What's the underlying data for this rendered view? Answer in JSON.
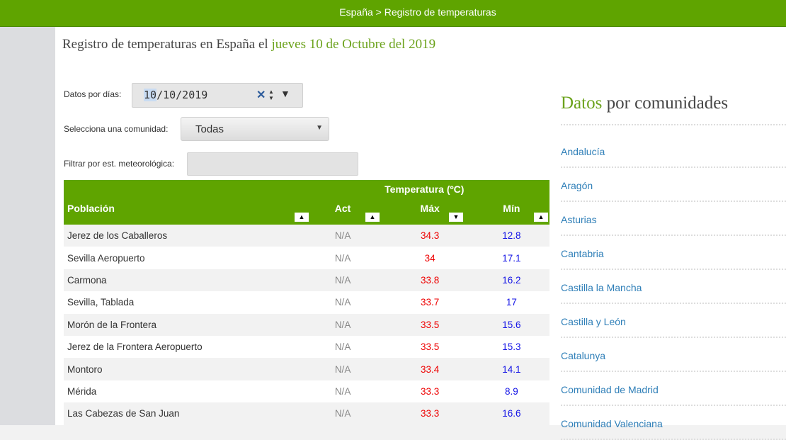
{
  "header": {
    "breadcrumb": "España > Registro de temperaturas"
  },
  "title": {
    "prefix": "Registro de temperaturas en España el",
    "date": "jueves 10 de Octubre del 2019"
  },
  "filters": {
    "date_label": "Datos por días:",
    "date_day": "10",
    "date_rest": "/10/2019",
    "community_label": "Selecciona una comunidad:",
    "community_value": "Todas",
    "station_label": "Filtrar por est. meteorológica:",
    "station_value": ""
  },
  "table": {
    "group_header": "Temperatura (ºC)",
    "headers": [
      "Población",
      "Act",
      "Máx",
      "Mín"
    ],
    "rows": [
      [
        "Jerez de los Caballeros",
        "N/A",
        "34.3",
        "12.8"
      ],
      [
        "Sevilla Aeropuerto",
        "N/A",
        "34",
        "17.1"
      ],
      [
        "Carmona",
        "N/A",
        "33.8",
        "16.2"
      ],
      [
        "Sevilla, Tablada",
        "N/A",
        "33.7",
        "17"
      ],
      [
        "Morón de la Frontera",
        "N/A",
        "33.5",
        "15.6"
      ],
      [
        "Jerez de la Frontera Aeropuerto",
        "N/A",
        "33.5",
        "15.3"
      ],
      [
        "Montoro",
        "N/A",
        "33.4",
        "14.1"
      ],
      [
        "Mérida",
        "N/A",
        "33.3",
        "8.9"
      ],
      [
        "Las Cabezas de San Juan",
        "N/A",
        "33.3",
        "16.6"
      ]
    ]
  },
  "sidebar": {
    "title_hl": "Datos",
    "title_rest": "por comunidades",
    "communities": [
      "Andalucía",
      "Aragón",
      "Asturias",
      "Cantabria",
      "Castilla la Mancha",
      "Castilla y León",
      "Catalunya",
      "Comunidad de Madrid",
      "Comunidad Valenciana"
    ]
  },
  "icons": {
    "clear": "clear-x-icon",
    "spinner": "spinner-arrows-icon",
    "dropdown": "triangle-down-icon",
    "sort": "sort-arrows-icon"
  },
  "colors": {
    "brand": "#5fa400",
    "accent_text": "#6ba21b",
    "max_temp": "#e00000",
    "min_temp": "#1414e6",
    "link": "#2f7fb8"
  }
}
